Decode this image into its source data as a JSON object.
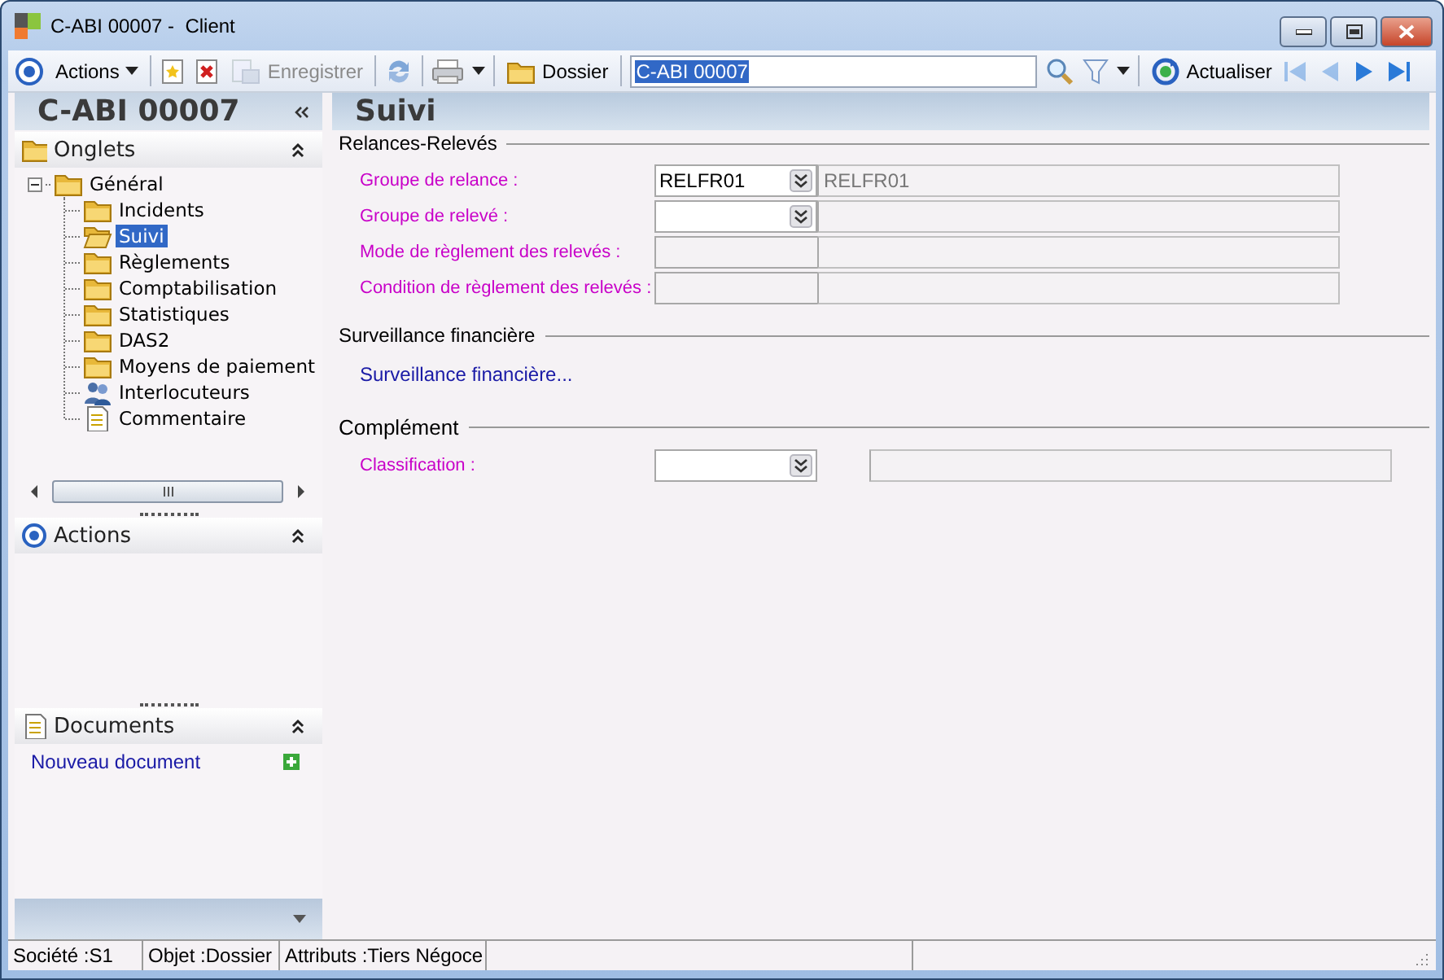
{
  "window": {
    "title": "C-ABI 00007 -  Client"
  },
  "toolbar": [
    {
      "kind": "target",
      "disabled": false
    },
    {
      "kind": "menu",
      "label": "Actions",
      "disabled": false
    },
    {
      "kind": "separator"
    },
    {
      "kind": "new",
      "disabled": false
    },
    {
      "kind": "delete",
      "disabled": false
    },
    {
      "kind": "save",
      "label": "Enregistrer",
      "disabled": true
    },
    {
      "kind": "separator"
    },
    {
      "kind": "refresh",
      "disabled": false
    },
    {
      "kind": "separator"
    },
    {
      "kind": "print",
      "disabled": false
    },
    {
      "kind": "dropdown",
      "disabled": false
    },
    {
      "kind": "separator"
    },
    {
      "kind": "folder",
      "label": "Dossier",
      "disabled": false
    },
    {
      "kind": "separator"
    },
    {
      "kind": "field",
      "value": "C-ABI 00007"
    },
    {
      "kind": "search",
      "disabled": false
    },
    {
      "kind": "filter",
      "disabled": false
    },
    {
      "kind": "dropdown",
      "disabled": false
    },
    {
      "kind": "separator"
    },
    {
      "kind": "sync",
      "label": "Actualiser",
      "disabled": false
    },
    {
      "kind": "first",
      "disabled": true
    },
    {
      "kind": "prev",
      "disabled": true
    },
    {
      "kind": "next",
      "disabled": false
    },
    {
      "kind": "last",
      "disabled": false
    }
  ],
  "sidebar": {
    "title": "C-ABI 00007",
    "sections": [
      {
        "kind": "tree",
        "title": "Onglets",
        "expanded": true,
        "tree": [
          {
            "label": "Général",
            "kind": "folder",
            "selected": false,
            "expanded": true,
            "children": [
              {
                "label": "Incidents",
                "kind": "folder",
                "selected": false
              },
              {
                "label": "Suivi",
                "kind": "folder",
                "selected": true
              },
              {
                "label": "Règlements",
                "kind": "folder",
                "selected": false
              },
              {
                "label": "Comptabilisation",
                "kind": "folder",
                "selected": false
              },
              {
                "label": "Statistiques",
                "kind": "folder",
                "selected": false
              },
              {
                "label": "DAS2",
                "kind": "folder",
                "selected": false
              },
              {
                "label": "Moyens de paiement",
                "kind": "folder",
                "selected": false
              },
              {
                "label": "Interlocuteurs",
                "kind": "contacts",
                "selected": false
              },
              {
                "label": "Commentaire",
                "kind": "note",
                "selected": false
              }
            ]
          }
        ]
      },
      {
        "kind": "actions",
        "title": "Actions",
        "expanded": true
      },
      {
        "kind": "documents",
        "title": "Documents",
        "expanded": true,
        "links": [
          "Nouveau document"
        ]
      }
    ]
  },
  "content": {
    "title": "Suivi",
    "groups": [
      {
        "title": "Relances-Relevés",
        "rows": [
          {
            "label": "Groupe de relance :",
            "kind": "combo",
            "value": "RELFR01",
            "description": "RELFR01"
          },
          {
            "label": "Groupe de relevé :",
            "kind": "combo"
          },
          {
            "label": "Mode de règlement des relevés :",
            "kind": "readonly"
          },
          {
            "label": "Condition de règlement des relevés :",
            "kind": "readonly"
          }
        ]
      },
      {
        "title": "Surveillance financière",
        "link": "Surveillance financière..."
      },
      {
        "title": "Complément",
        "rows": [
          {
            "label": "Classification :",
            "kind": "combo",
            "detached": true
          }
        ]
      }
    ]
  },
  "status_bar": [
    "Société :S1",
    "Objet :Dossier",
    "Attributs :Tiers Négoce"
  ]
}
